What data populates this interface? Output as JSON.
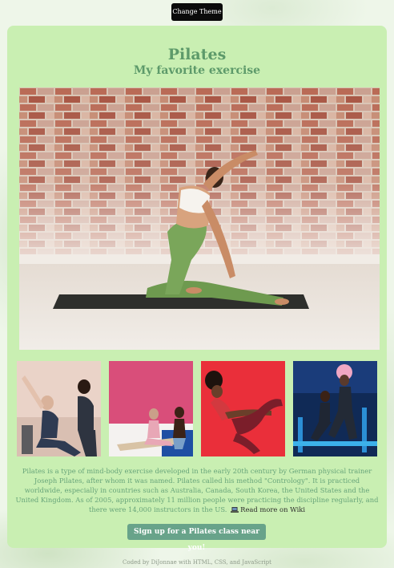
{
  "theme_button": {
    "label": "Change Theme"
  },
  "header": {
    "title": "Pilates",
    "subtitle": "My favorite exercise"
  },
  "hero_image": {
    "alt": "Woman stretching on a yoga mat in front of a brick wall"
  },
  "gallery": [
    {
      "alt": "Two women doing pilates on a reformer"
    },
    {
      "alt": "Two women stretching on mats against a pink wall"
    },
    {
      "alt": "Woman doing a core exercise against a red background"
    },
    {
      "alt": "Women on reformers in a blue-lit studio"
    }
  ],
  "description": {
    "text": "Pilates is a type of mind-body exercise developed in the early 20th century by German physical trainer Joseph Pilates, after whom it was named. Pilates called his method \"Contrology\". It is practiced worldwide, especially in countries such as Australia, Canada, South Korea, the United States and the United Kingdom. As of 2005, approximately 11 million people were practicing the discipline regularly, and there were 14,000 instructors in the US.",
    "link_text": "Read more on Wiki",
    "link_icon": "laptop-icon"
  },
  "signup_button": {
    "label": "Sign up for a Pilates class near you!"
  },
  "footer": {
    "prefix": "Coded by ",
    "author": "DiJonnae",
    "suffix": " with HTML, CSS, and JavaScript"
  },
  "colors": {
    "card_background": "#c9efb2",
    "heading": "#5d9a6a",
    "body_text": "#68a57a",
    "signup_button": "#68a38a",
    "theme_button": "#0b0b0b"
  }
}
